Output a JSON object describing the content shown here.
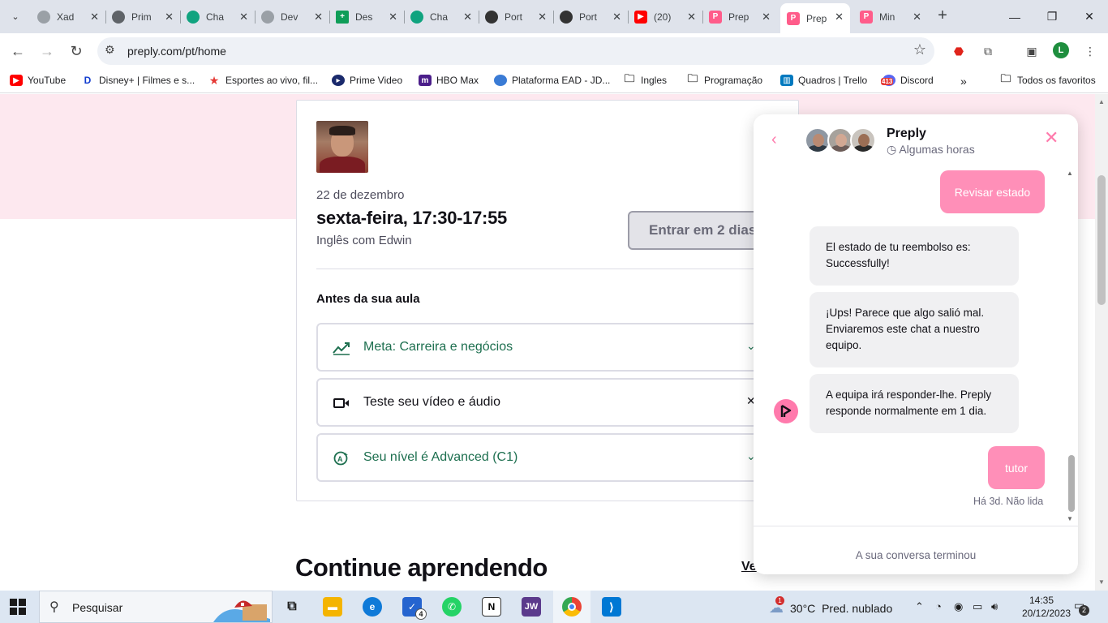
{
  "browser": {
    "tabs": [
      {
        "title": "Xad",
        "color": "#9aa0a6"
      },
      {
        "title": "Prim",
        "color": "#5f6368"
      },
      {
        "title": "Cha",
        "color": "#10a37f"
      },
      {
        "title": "Dev",
        "color": "#9aa0a6"
      },
      {
        "title": "Des",
        "color": "#0f9d58"
      },
      {
        "title": "Cha",
        "color": "#10a37f"
      },
      {
        "title": "Port",
        "color": "#333333"
      },
      {
        "title": "Port",
        "color": "#333333"
      },
      {
        "title": "(20)",
        "color": "#ff0000"
      },
      {
        "title": "Prep",
        "color": "#ff5c8a"
      },
      {
        "title": "Prep",
        "color": "#ff5c8a"
      },
      {
        "title": "Min",
        "color": "#ff5c8a"
      }
    ],
    "url": "preply.com/pt/home",
    "profile_initial": "L",
    "bookmarks": [
      {
        "label": "YouTube"
      },
      {
        "label": "Disney+ | Filmes e s..."
      },
      {
        "label": "Esportes ao vivo, fil..."
      },
      {
        "label": "Prime Video"
      },
      {
        "label": "HBO Max"
      },
      {
        "label": "Plataforma EAD - JD..."
      },
      {
        "label": "Ingles"
      },
      {
        "label": "Programação"
      },
      {
        "label": "Quadros | Trello"
      },
      {
        "label": "Discord"
      }
    ],
    "discord_badge": "413",
    "all_favorites": "Todos os favoritos"
  },
  "lesson": {
    "date": "22 de dezembro",
    "time": "sexta-feira, 17:30-17:55",
    "with": "Inglês com Edwin",
    "enter_button": "Entrar em 2 dias",
    "before_title": "Antes da sua aula",
    "items": [
      {
        "label": "Meta: Carreira e negócios"
      },
      {
        "label": "Teste seu vídeo e áudio"
      },
      {
        "label": "Seu nível é Advanced (C1)"
      }
    ]
  },
  "continue": {
    "title": "Continue aprendendo",
    "link": "Ve"
  },
  "chat": {
    "title": "Preply",
    "subtitle": "Algumas horas",
    "messages": {
      "m1": "Revisar estado",
      "m2": "El estado de tu reembolso es: Successfully!",
      "m3": "¡Ups! Parece que algo salió mal. Enviaremos este chat a nuestro equipo.",
      "m4": "A equipa irá responder-lhe. Preply responde normalmente em 1 dia.",
      "m5": "tutor"
    },
    "meta": "Há 3d. Não lida",
    "footer": "A sua conversa terminou"
  },
  "taskbar": {
    "search_placeholder": "Pesquisar",
    "todo_badge": "4",
    "weather_temp": "30°C",
    "weather_desc": "Pred. nublado",
    "weather_badge": "1",
    "time": "14:35",
    "date": "20/12/2023",
    "notif_count": "2"
  },
  "colors": {
    "brand_pink": "#ff7aac",
    "bubble_pink": "#ff8fb8",
    "green": "#1d6f4f",
    "band": "#fde8ef"
  }
}
